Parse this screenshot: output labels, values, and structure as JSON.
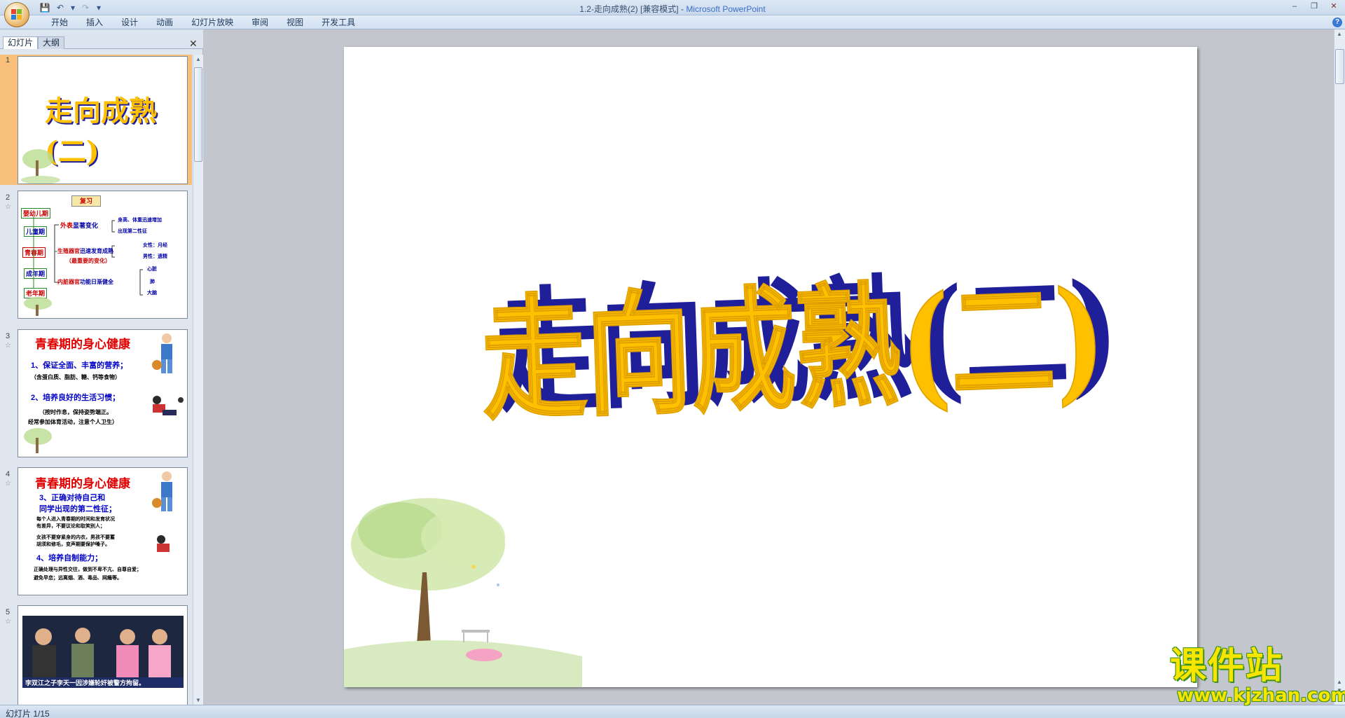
{
  "window": {
    "title": "1.2-走向成熟(2) [兼容模式] - ",
    "app_name": "Microsoft PowerPoint",
    "min": "–",
    "max": "❐",
    "close": "✕"
  },
  "quick_access": {
    "save": "💾",
    "undo": "↶",
    "undo_dd": "▾",
    "redo": "↷",
    "customize": "▾"
  },
  "ribbon": {
    "tabs": [
      "开始",
      "插入",
      "设计",
      "动画",
      "幻灯片放映",
      "审阅",
      "视图",
      "开发工具"
    ],
    "help": "?"
  },
  "panel": {
    "tab_slides": "幻灯片",
    "tab_outline": "大纲",
    "close": "✕"
  },
  "thumbnails": [
    {
      "number": "1",
      "title": "走向成熟(二)"
    },
    {
      "number": "2",
      "banner": "复习",
      "stages": [
        "婴幼儿期",
        "儿童期",
        "青春期",
        "成年期",
        "老年期"
      ],
      "branches": [
        {
          "label": "外表显著变化",
          "red": "外表",
          "rest": "显著变化",
          "items": [
            "身高、体重迅速增加",
            "出现第二性征"
          ]
        },
        {
          "label": "生殖器官迅速发育成熟",
          "red": "生殖器官",
          "rest": "迅速发育成熟",
          "note": "（最重要的变化）",
          "items": [
            "女性：月经",
            "男性：遗精"
          ]
        },
        {
          "label": "内脏器官功能日渐健全",
          "red": "内脏器官",
          "rest": "功能日渐健全",
          "items": [
            "心脏",
            "肺",
            "大脑"
          ]
        }
      ]
    },
    {
      "number": "3",
      "title": "青春期的身心健康",
      "lines": [
        "1、保证全面、丰富的营养；",
        "（含蛋白质、脂肪、糖、钙等食物）",
        "2、培养良好的生活习惯；",
        "（按时作息，保持姿势端正。",
        "经常参加体育活动，注意个人卫生）"
      ]
    },
    {
      "number": "4",
      "title": "青春期的身心健康",
      "lines": [
        "3、正确对待自己和",
        "同学出现的第二性征；",
        "每个人进入青春期的时间和发育状况",
        "有差异，不要议论和取笑别人；",
        "女孩不要穿紧身的内衣，男孩不要蓄",
        "胡须和修毛，变声期要保护嗓子。",
        "4、培养自制能力；",
        "正确处理与异性交往，做到不卑不亢、自尊自爱；",
        "避免早恋；远离烟、酒、毒品、网瘾等。"
      ]
    },
    {
      "number": "5",
      "caption": "李双江之子李天一因涉嫌轮奸被警方拘留。"
    }
  ],
  "slide": {
    "title": "走向成熟(二)",
    "title_fill": "#ffc000",
    "title_shadow": "#1f1f9a"
  },
  "status": {
    "slide_counter": "幻灯片 1/15"
  },
  "watermark": {
    "name": "课件站",
    "url": "www.kjzhan.com"
  }
}
